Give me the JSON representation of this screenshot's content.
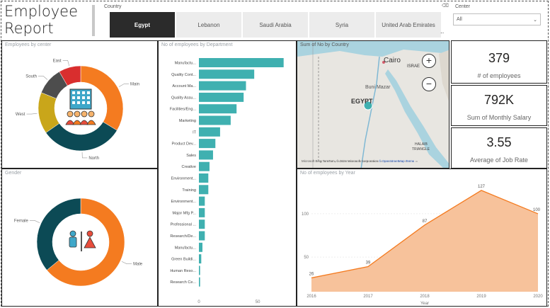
{
  "header": {
    "title_line1": "Employee",
    "title_line2": "Report",
    "country_filter_label": "Country",
    "country_tabs": [
      "Egypt",
      "Lebanon",
      "Saudi Arabia",
      "Syria",
      "United Arab Emirates"
    ],
    "active_country": "Egypt",
    "center_filter_label": "Center",
    "center_selected": "All"
  },
  "kpis": [
    {
      "value": "379",
      "label": "# of employees"
    },
    {
      "value": "792K",
      "label": "Sum of Monthly Salary"
    },
    {
      "value": "3.55",
      "label": "Average of Job Rate"
    }
  ],
  "map": {
    "title": "Sum of No by Country",
    "labels": {
      "cairo": "Cairo",
      "egypt": "EGYPT",
      "israel": "ISRAE",
      "beni": "Buni Mazar",
      "halaib": "HALAIB",
      "triangle": "TRIANGLE"
    },
    "attribution": "Microsoft Bing  TomTom, © 2024 Microsoft Corporation",
    "osm": "© OpenStreetMap",
    "terms": "Terms",
    "zoom_in": "+",
    "zoom_out": "−"
  },
  "chart_data": [
    {
      "type": "pie",
      "title": "Employees by center",
      "labels": [
        "Main",
        "North",
        "West",
        "South",
        "East"
      ],
      "values": [
        32,
        30,
        15,
        10,
        8
      ],
      "colors": [
        "#f47b20",
        "#0c4a55",
        "#c9a61a",
        "#4d4d4d",
        "#d92e2e"
      ],
      "donut": true
    },
    {
      "type": "pie",
      "title": "Gender",
      "labels": [
        "Male",
        "Female"
      ],
      "values": [
        64,
        36
      ],
      "colors": [
        "#f47b20",
        "#0c4a55"
      ],
      "donut": true
    },
    {
      "type": "bar",
      "orientation": "horizontal",
      "title": "No of employees by Department",
      "categories": [
        "Manufactu...",
        "Quality Cont...",
        "Account Ma...",
        "Quality Assu...",
        "Facilities/Eng...",
        "Marketing",
        "IT",
        "Product Dev...",
        "Sales",
        "Creative",
        "Environment...",
        "Training",
        "Environment...",
        "Major Mfg P...",
        "Professional ...",
        "Research/De...",
        "Manufactu...",
        "Green Buildi...",
        "Human Reso...",
        "Research Ce..."
      ],
      "values": [
        72,
        47,
        40,
        38,
        32,
        27,
        18,
        14,
        12,
        9,
        8,
        8,
        5,
        5,
        5,
        5,
        3,
        2,
        1,
        1
      ],
      "xticks": [
        0,
        50
      ],
      "xlim": [
        0,
        80
      ],
      "color": "#3fb0b0"
    },
    {
      "type": "area",
      "title": "No of employees by Year",
      "x": [
        "2016",
        "2017",
        "2018",
        "2019",
        "2020"
      ],
      "values": [
        26,
        39,
        87,
        127,
        100
      ],
      "xlabel": "Year",
      "yticks": [
        50,
        100
      ],
      "ylim": [
        10,
        140
      ],
      "color": "#f47b20",
      "fill": "#f7c29b"
    }
  ]
}
